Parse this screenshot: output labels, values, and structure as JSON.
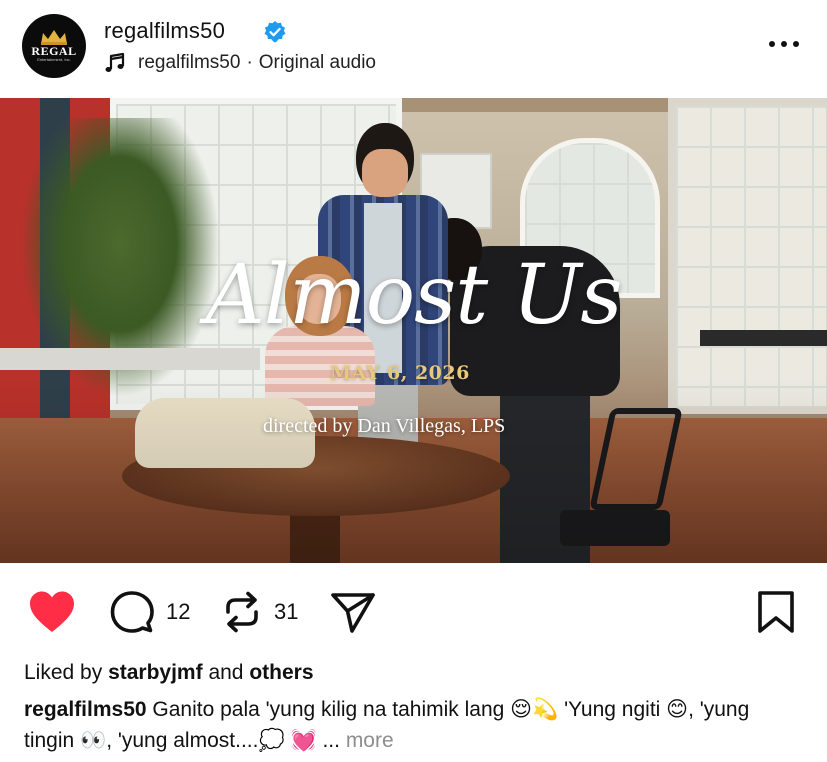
{
  "header": {
    "avatar_text": "REGAL",
    "avatar_subtext": "Entertainment, Inc.",
    "username": "regalfilms50",
    "audio_user": "regalfilms50",
    "audio_separator": "·",
    "audio_label": "Original audio"
  },
  "video": {
    "title": "Almost Us",
    "date": "MAY 6, 2026",
    "director": "directed by Dan Villegas, LPS"
  },
  "actions": {
    "comments_count": "12",
    "reposts_count": "31"
  },
  "likes": {
    "prefix": "Liked by",
    "user": "starbyjmf",
    "and": "and",
    "others": "others"
  },
  "caption": {
    "user": "regalfilms50",
    "text1": "Ganito pala 'yung kilig na tahimik lang",
    "emoji1": "😌",
    "emoji2": "💫",
    "text2": "'Yung ngiti",
    "emoji3": "😊",
    "text3": ", 'yung tingin",
    "emoji4": "👀",
    "text4": ", 'yung almost....",
    "emoji5": "💭",
    "emoji6": "💓",
    "ellipsis": "...",
    "more": "more"
  },
  "colors": {
    "like": "#ff2d46",
    "verified": "#1d9bf0",
    "date_gold": "#e8c77e",
    "muted": "#8e8e8e"
  },
  "icons": [
    "music-icon",
    "verified-badge-icon",
    "more-options-icon",
    "user-icon",
    "sound-icon",
    "heart-icon",
    "comment-icon",
    "repost-icon",
    "share-icon",
    "bookmark-icon"
  ]
}
